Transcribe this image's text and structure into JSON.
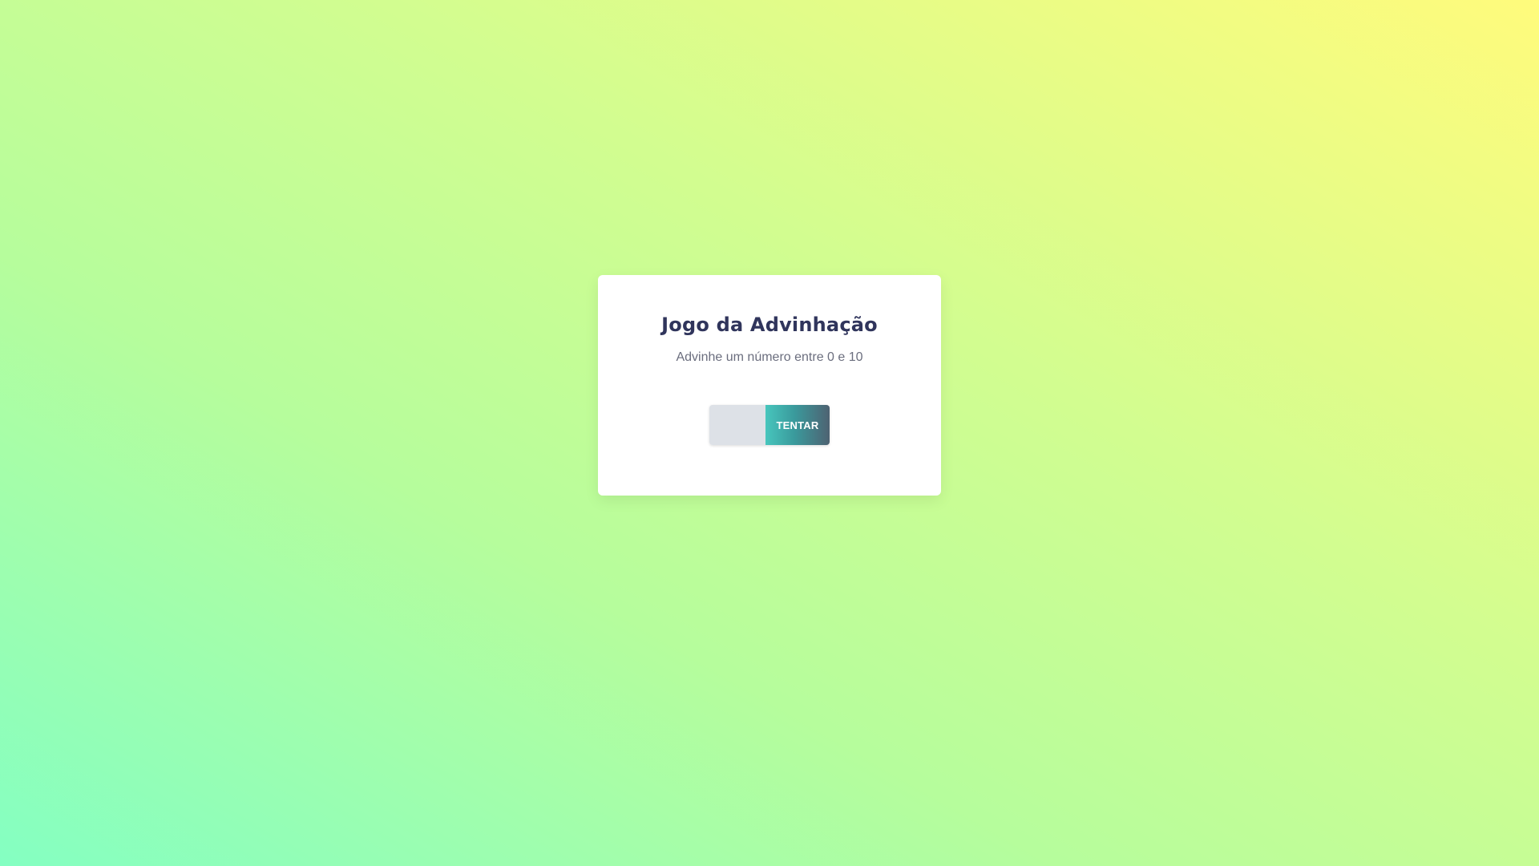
{
  "card": {
    "title": "Jogo da Advinhação",
    "subtitle": "Advinhe um número entre 0 e 10"
  },
  "form": {
    "input_value": "",
    "input_placeholder": "",
    "button_label": "TENTAR"
  },
  "colors": {
    "background_gradient": [
      "#84ffc2",
      "#b6fd9c",
      "#d2fd90",
      "#fffb7c"
    ],
    "title_color": "#30355c",
    "subtitle_color": "#6b6e7e",
    "input_background": "#dde1e7",
    "button_gradient": [
      "#47c6bd",
      "#3a9a9c",
      "#4e6272"
    ]
  }
}
